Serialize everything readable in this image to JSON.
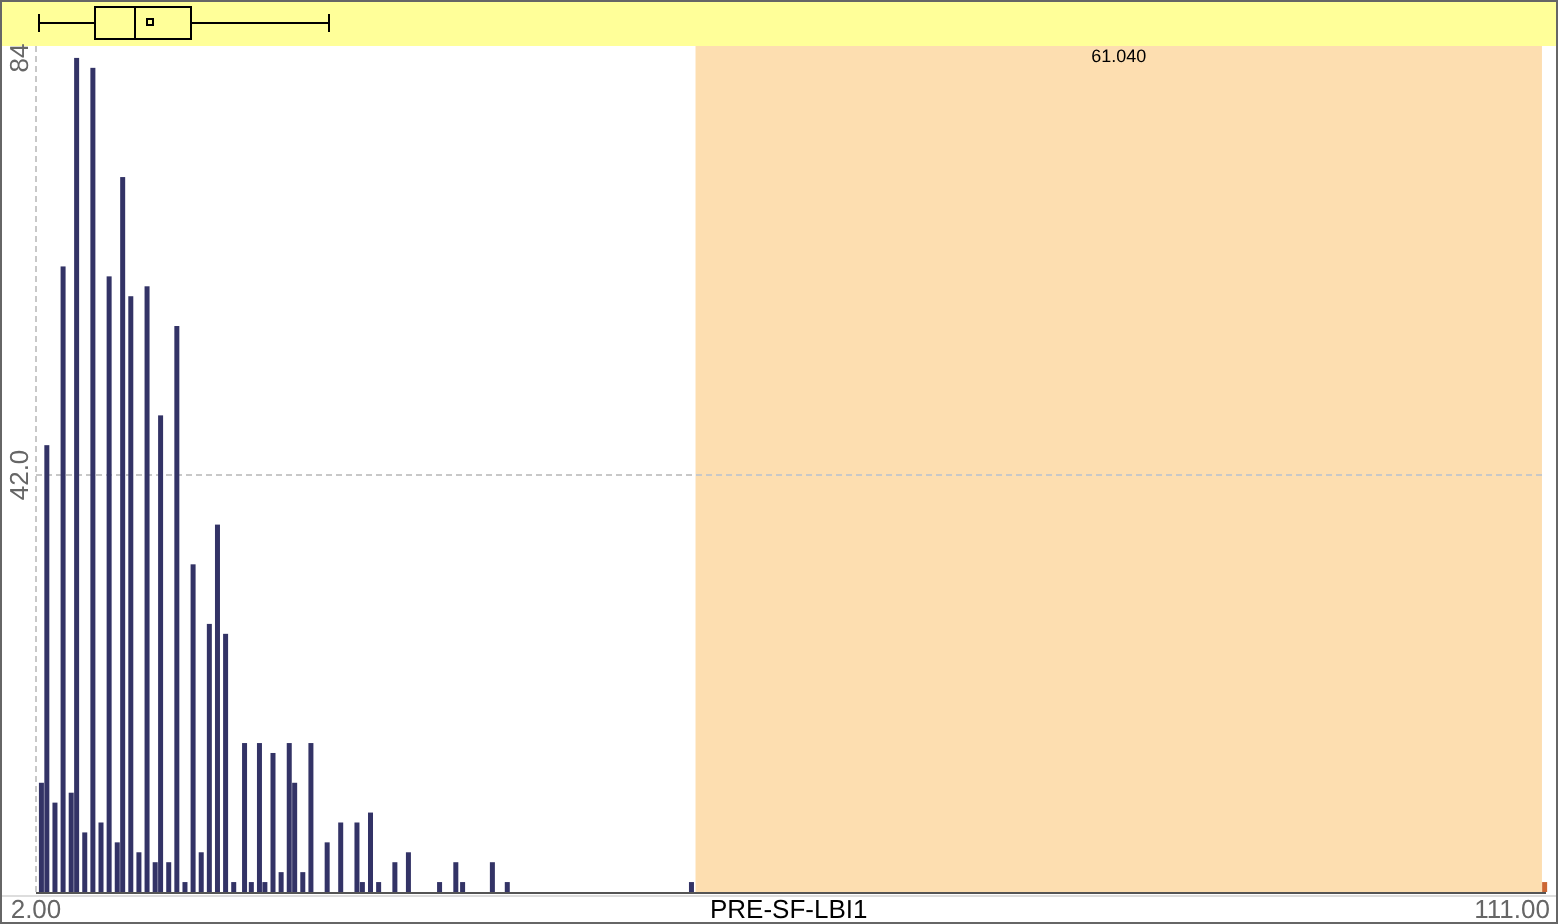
{
  "chart_data": {
    "type": "bar",
    "xlabel": "PRE-SF-LBI1",
    "xlim": [
      2,
      113.5
    ],
    "ylim": [
      0,
      85.2
    ],
    "xticks": [
      {
        "value": 2,
        "label": "2.00"
      },
      {
        "value": 111,
        "label": "111.00"
      }
    ],
    "yticks": [
      {
        "value": 42,
        "label": "42.0"
      },
      {
        "value": 84,
        "label": "84"
      }
    ],
    "x": [
      2.4,
      2.8,
      3.4,
      4.0,
      4.6,
      5.0,
      5.6,
      6.2,
      6.8,
      7.4,
      8.0,
      8.4,
      9.0,
      9.6,
      10.2,
      10.8,
      11.2,
      11.8,
      12.4,
      13.0,
      13.6,
      14.2,
      14.8,
      15.4,
      16.0,
      16.6,
      17.4,
      17.9,
      18.5,
      18.9,
      19.5,
      20.1,
      20.7,
      21.1,
      21.7,
      22.3,
      23.5,
      24.5,
      25.7,
      26.1,
      26.7,
      27.3,
      28.5,
      29.5,
      31.8,
      33.0,
      33.5,
      35.7,
      36.8,
      50.4,
      113.4
    ],
    "series": [
      {
        "color": "#333366",
        "values": [
          11,
          45,
          9,
          63,
          10,
          84,
          6,
          83,
          7,
          62,
          5,
          72,
          60,
          4,
          61,
          3,
          48,
          3,
          57,
          1,
          33,
          4,
          27,
          37,
          26,
          1,
          15,
          1,
          15,
          1,
          14,
          2,
          15,
          11,
          2,
          15,
          5,
          7,
          7,
          1,
          8,
          1,
          3,
          4,
          1,
          3,
          1,
          3,
          1,
          1,
          null
        ]
      },
      {
        "color": "#cc6633",
        "values": [
          null,
          null,
          null,
          null,
          null,
          null,
          null,
          null,
          null,
          null,
          null,
          null,
          null,
          null,
          null,
          null,
          null,
          null,
          null,
          null,
          null,
          null,
          null,
          null,
          null,
          null,
          null,
          null,
          null,
          null,
          null,
          null,
          null,
          null,
          null,
          null,
          null,
          null,
          null,
          null,
          null,
          null,
          null,
          null,
          null,
          null,
          null,
          null,
          null,
          null,
          1
        ]
      }
    ],
    "bands": [
      {
        "axis": "x",
        "from": 50.7,
        "to": 113.2,
        "color": "#fddeb0"
      }
    ],
    "annotations": [
      "61.040"
    ]
  }
}
